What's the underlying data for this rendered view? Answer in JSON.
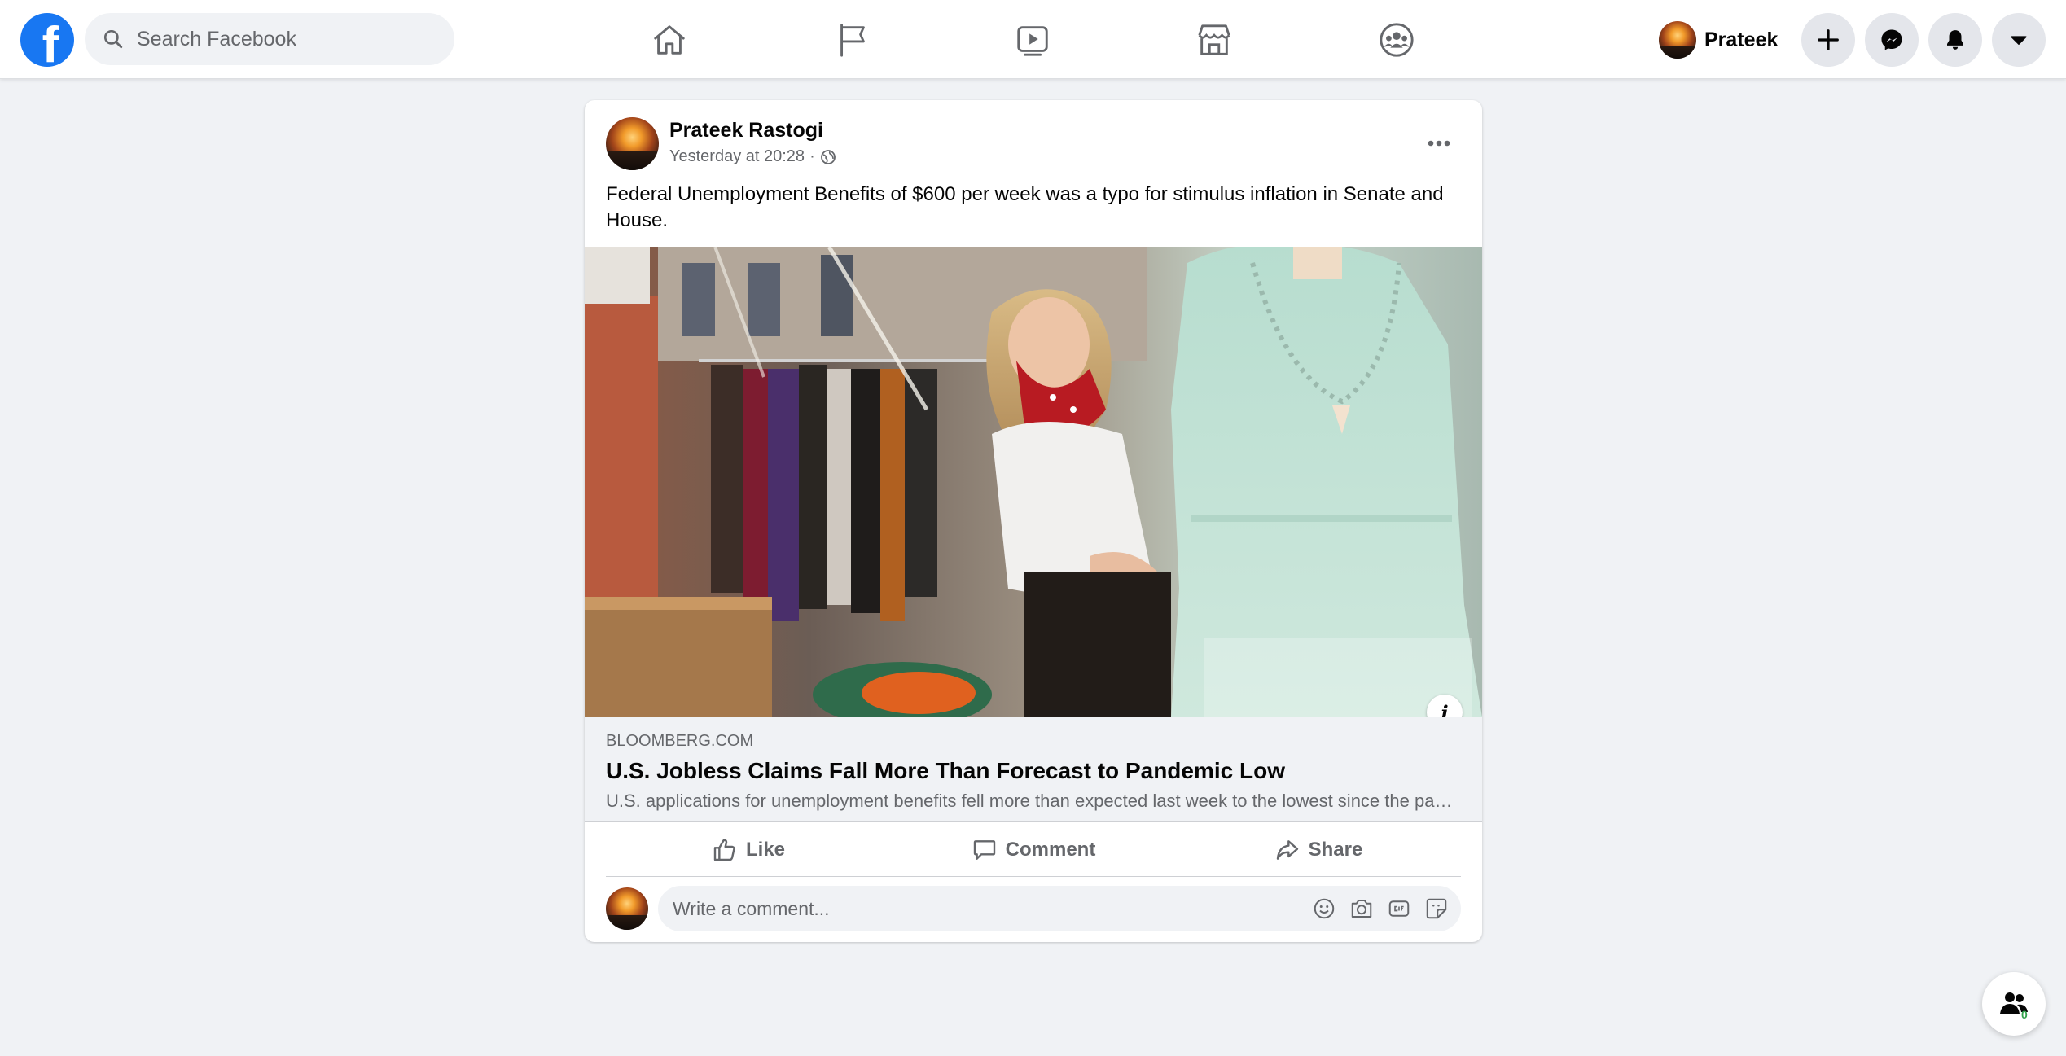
{
  "header": {
    "logo_letter": "f",
    "search": {
      "placeholder": "Search Facebook",
      "value": ""
    },
    "nav_tabs": [
      {
        "name": "home",
        "icon": "home-icon"
      },
      {
        "name": "pages",
        "icon": "flag-icon"
      },
      {
        "name": "watch",
        "icon": "video-play-icon"
      },
      {
        "name": "marketplace",
        "icon": "store-icon"
      },
      {
        "name": "groups",
        "icon": "groups-icon"
      }
    ],
    "profile_name": "Prateek",
    "buttons": [
      {
        "name": "create",
        "icon": "plus-icon"
      },
      {
        "name": "messenger",
        "icon": "messenger-icon"
      },
      {
        "name": "notifications",
        "icon": "bell-icon"
      },
      {
        "name": "account",
        "icon": "caret-down-icon"
      }
    ]
  },
  "post": {
    "author": "Prateek Rastogi",
    "timestamp": "Yesterday at 20:28",
    "separator": "·",
    "privacy_icon": "globe-icon",
    "text": "Federal Unemployment Benefits of $600 per week was a typo for stimulus inflation in Senate and House.",
    "link": {
      "domain": "BLOOMBERG.COM",
      "title": "U.S. Jobless Claims Fall More Than Forecast to Pandemic Low",
      "description": "U.S. applications for unemployment benefits fell more than expected last week to the lowest since the pandemic began"
    },
    "info_label": "i",
    "actions": {
      "like": "Like",
      "comment": "Comment",
      "share": "Share"
    },
    "comment_placeholder": "Write a comment..."
  },
  "contacts_fab": {
    "count": "0",
    "icon": "contacts-icon"
  },
  "colors": {
    "brand": "#1877f2",
    "background": "#f0f2f5",
    "secondary_text": "#65676b",
    "online": "#31a24c"
  }
}
